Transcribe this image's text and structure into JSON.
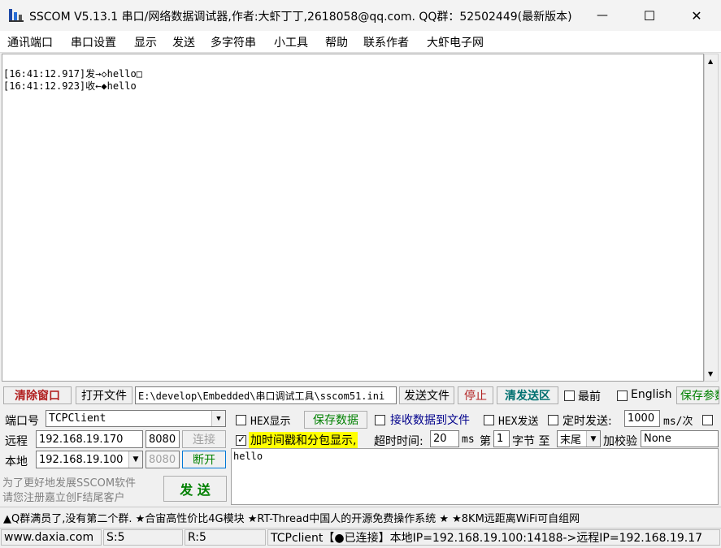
{
  "window": {
    "title": "SSCOM V5.13.1 串口/网络数据调试器,作者:大虾丁丁,2618058@qq.com. QQ群：52502449(最新版本)",
    "minimize_glyph": "—",
    "maximize_glyph": "☐",
    "close_glyph": "✕"
  },
  "menu": [
    "通讯端口",
    "串口设置",
    "显示",
    "发送",
    "多字符串",
    "小工具",
    "帮助",
    "联系作者",
    "大虾电子网"
  ],
  "receive": {
    "lines": [
      "[16:41:12.917]发→◇hello□",
      "[16:41:12.923]收←◆hello"
    ]
  },
  "toolbar": {
    "clear_window": "清除窗口",
    "open_file": "打开文件",
    "file_path": "E:\\develop\\Embedded\\串口调试工具\\sscom51.ini",
    "send_file": "发送文件",
    "stop": "停止",
    "clear_send": "清发送区",
    "topmost": "最前",
    "english": "English",
    "save_params": "保存参数"
  },
  "connection": {
    "port_label": "端口号",
    "port_value": "TCPClient",
    "remote_label": "远程",
    "remote_ip": "192.168.19.170",
    "remote_port": "8080",
    "connect": "连接",
    "local_label": "本地",
    "local_ip": "192.168.19.100",
    "local_port": "8080",
    "disconnect": "断开",
    "promo_line1": "为了更好地发展SSCOM软件",
    "promo_line2": "请您注册嘉立创F结尾客户",
    "send": "发 送"
  },
  "options": {
    "hex_display": "HEX显示",
    "save_data": "保存数据",
    "recv_to_file": "接收数据到文件",
    "hex_send": "HEX发送",
    "timed_send": "定时发送:",
    "timed_value": "1000",
    "timed_unit": "ms/次",
    "timestamp": "加时间戳和分包显示,",
    "timeout_label": "超时时间:",
    "timeout_value": "20",
    "timeout_unit": "ms",
    "byte_prefix": "第",
    "byte_index": "1",
    "byte_mid": "字节 至",
    "byte_end": "末尾",
    "checksum_label": "加校验",
    "checksum_value": "None"
  },
  "send_area": {
    "text": "hello"
  },
  "promo_bar": "▲Q群满员了,没有第二个群. ★合宙高性价比4G模块 ★RT-Thread中国人的开源免费操作系统 ★ ★8KM远距离WiFi可自组网",
  "status": {
    "site": "www.daxia.com",
    "sent": "S:5",
    "received": "R:5",
    "connection": "TCPclient【●已连接】本地IP=192.168.19.100:14188->远程IP=192.168.19.17"
  },
  "colors": {
    "highlight_yellow": "#ffff00",
    "clear_red": "#b22222",
    "green": "#008000",
    "teal": "#007070"
  }
}
